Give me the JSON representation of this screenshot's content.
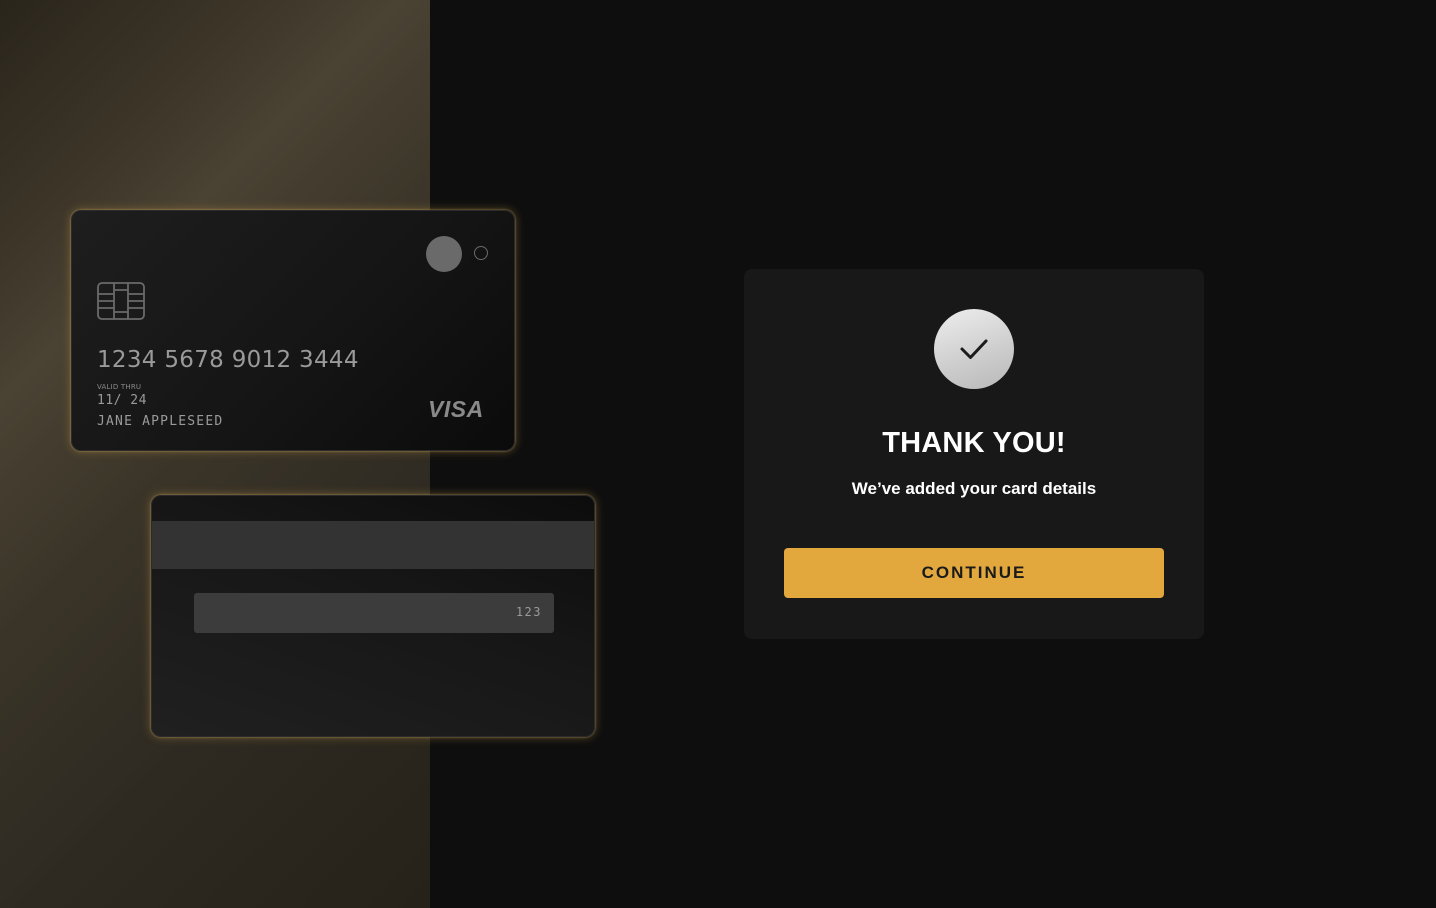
{
  "card_front": {
    "number": "1234 5678 9012 3444",
    "valid_label": "VALID THRU",
    "expiry": "11/ 24",
    "holder": "JANE APPLESEED",
    "brand": "VISA"
  },
  "card_back": {
    "cvv": "123"
  },
  "confirmation": {
    "title": "THANK YOU!",
    "subtitle": "We’ve added your card details",
    "button_label": "CONTINUE"
  },
  "colors": {
    "accent": "#e2a83d",
    "background": "#0e0e0e",
    "panel": "#181818"
  },
  "icons": {
    "status": "checkmark-icon",
    "chip": "card-chip-icon"
  }
}
